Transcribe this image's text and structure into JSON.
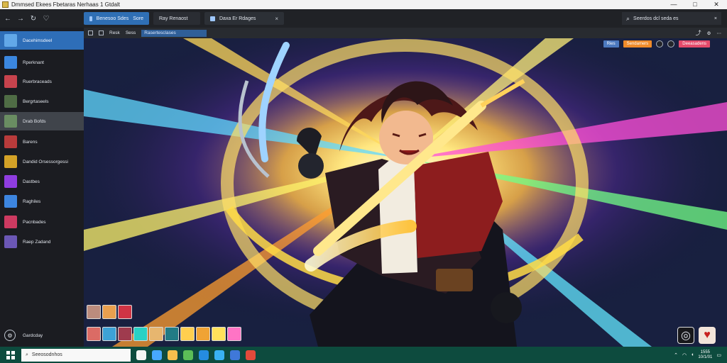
{
  "window": {
    "title": "Dmmsed Ekees Fbetaras Nerhaas 1 Gtdalt",
    "app_icon": "app-icon",
    "controls": [
      "minimize-icon",
      "maximize-icon",
      "close-icon"
    ]
  },
  "nav": {
    "back": "←",
    "forward": "→",
    "refresh": "↻",
    "favorite": "♡",
    "tabs": [
      {
        "label": "Benesoo Sdes",
        "action": "Sore"
      },
      {
        "label": "Ray Renaost"
      },
      {
        "label": "Daxa Er Rdages"
      }
    ],
    "search_text": "Seerdos dcl seda es",
    "search_icon": "search-icon"
  },
  "sidebar": {
    "items": [
      {
        "label": "Dacehimsdeel",
        "thumb": "#62a8e8"
      },
      {
        "label": "Rperknant",
        "thumb": "#3b87df"
      },
      {
        "label": "Ruerbraceads",
        "thumb": "#c7434d"
      },
      {
        "label": "Bergrtaseels",
        "thumb": "#4f6c45"
      },
      {
        "label": "Drab Bofds",
        "thumb": "#6a8d62"
      },
      {
        "label": "Barens",
        "thumb": "#b83b3b"
      },
      {
        "label": "Dandid Orsessorgessi",
        "thumb": "#d4a227"
      },
      {
        "label": "Dastbes",
        "thumb": "#8f3de0"
      },
      {
        "label": "Raghiles",
        "thumb": "#3d86e0"
      },
      {
        "label": "Pacnbades",
        "thumb": "#cd3a61"
      },
      {
        "label": "Raep Zadand",
        "thumb": "#6b57b5"
      }
    ],
    "settings_label": "Gardcday",
    "settings_icon": "gear-icon"
  },
  "toolbar": {
    "address": "Rasertesclases",
    "items": [
      "Resk",
      "Sess"
    ]
  },
  "overlay": {
    "pills": [
      "Ries",
      "Sendamers",
      "Deeasadens"
    ],
    "bottom_icons": [
      "target-icon",
      "lips-icon"
    ]
  },
  "taskbar": {
    "search_placeholder": "Seeosodnhos",
    "time": "1555",
    "date": "10/1/01"
  },
  "colors": {
    "accent": "#2f6fb4",
    "taskbar": "#0d4b3e",
    "sidebar": "#1b1c21",
    "energy": "#ffd95a",
    "magic": "#b450ff"
  }
}
